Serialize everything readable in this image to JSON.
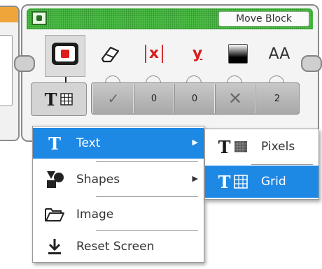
{
  "block": {
    "title": "Move Block",
    "params": {
      "erase": "✓",
      "x": "0",
      "y": "0",
      "color": "✕",
      "size": "2"
    },
    "labels": {
      "x": "x",
      "y": "y",
      "size": "AA"
    }
  },
  "menu": {
    "items": [
      {
        "label": "Text",
        "icon": "text-t-icon",
        "has_submenu": true,
        "selected": true
      },
      {
        "label": "Shapes",
        "icon": "shapes-icon",
        "has_submenu": true,
        "selected": false
      },
      {
        "label": "Image",
        "icon": "folder-open-icon",
        "has_submenu": false,
        "selected": false
      },
      {
        "label": "Reset Screen",
        "icon": "download-icon",
        "has_submenu": false,
        "selected": false
      }
    ]
  },
  "submenu": {
    "items": [
      {
        "label": "Pixels",
        "icon": "text-pixels-icon",
        "selected": false
      },
      {
        "label": "Grid",
        "icon": "text-grid-icon",
        "selected": true
      }
    ]
  },
  "colors": {
    "header_green": "#4fc04a",
    "selection_blue": "#1e88e5",
    "param_red": "#d81c1c"
  }
}
